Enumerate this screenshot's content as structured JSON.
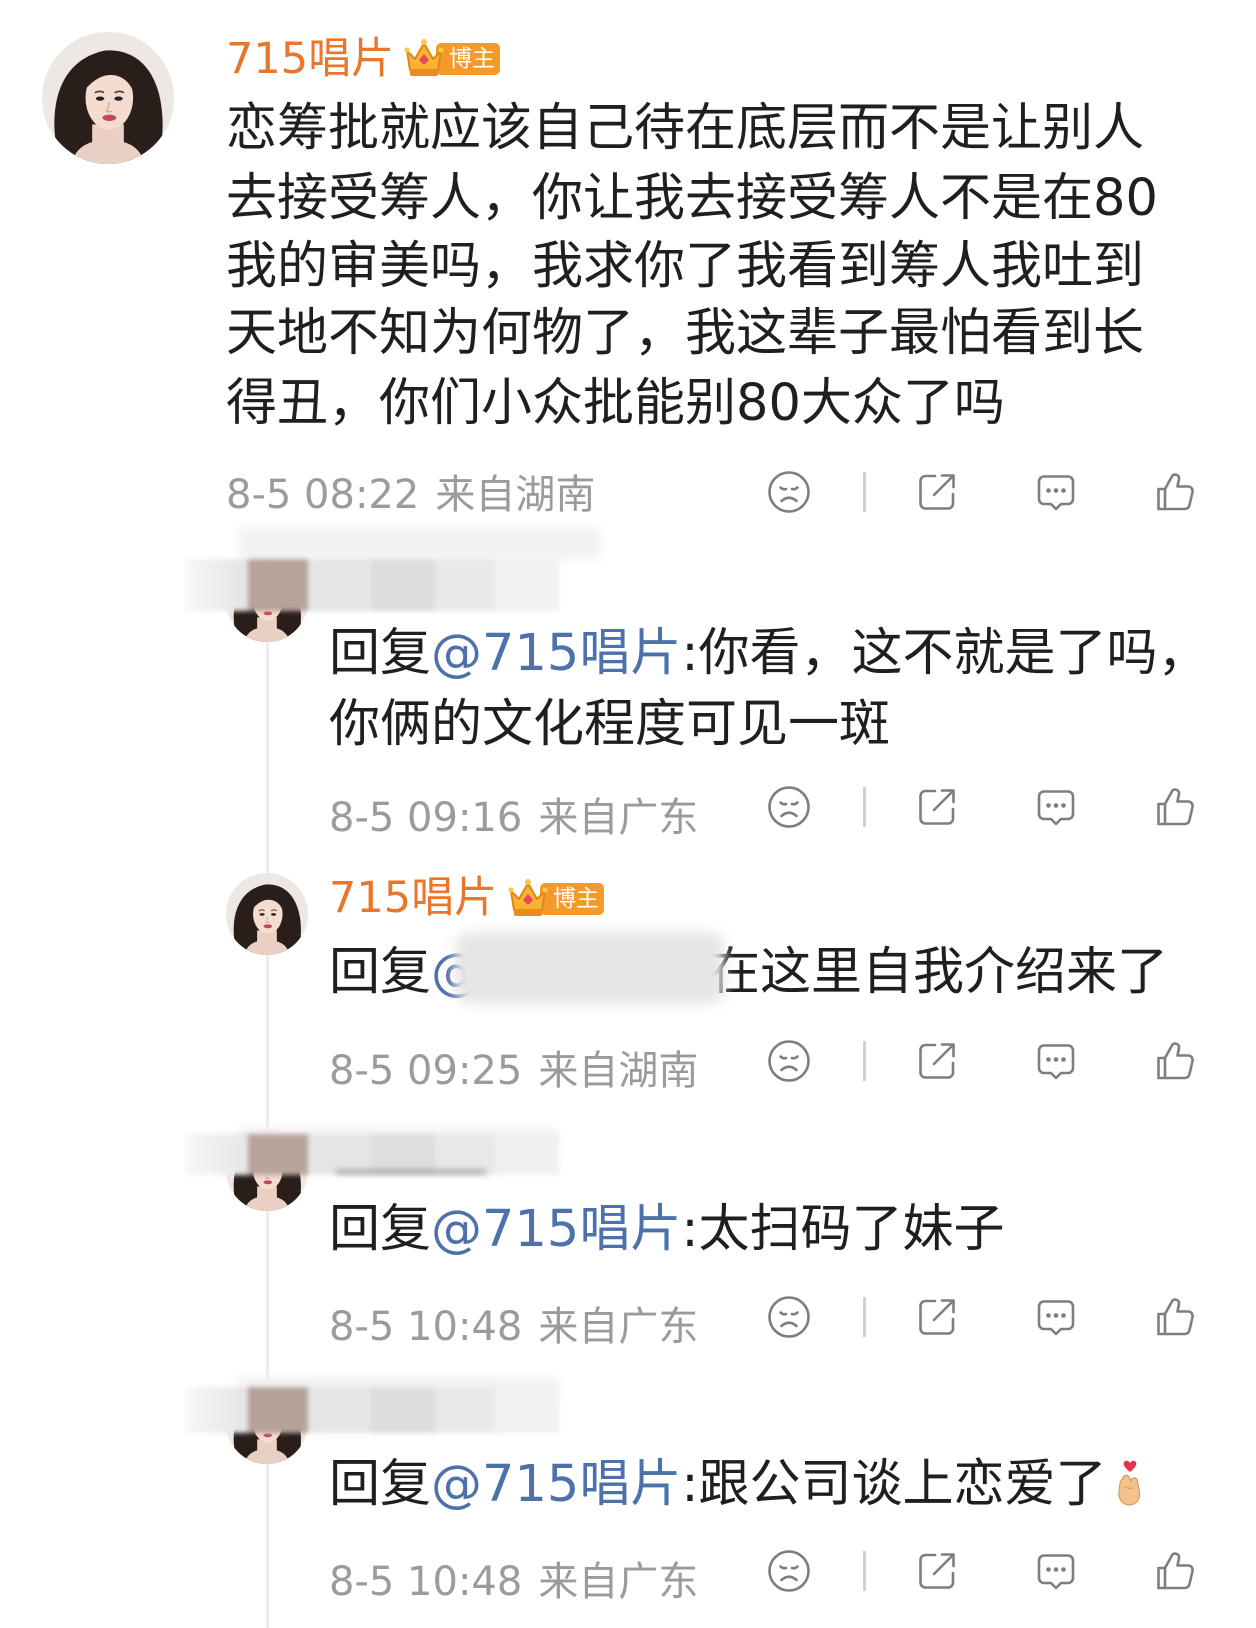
{
  "colors": {
    "username": "#E8762D",
    "mention": "#4D72AB",
    "text": "#1F1F1F",
    "meta": "#9B9B9B",
    "icon": "#7E7E7E",
    "badge": "#F39A2B"
  },
  "comment": {
    "author": "715唱片",
    "badge": "博主",
    "lines": [
      "恋筹批就应该自己待在底层而不是让别人",
      "去接受筹人，你让我去接受筹人不是在80",
      "我的审美吗，我求你了我看到筹人我吐到",
      "天地不知为何物了，我这辈子最怕看到长",
      "得丑，你们小众批能别80大众了吗"
    ],
    "time": "8-5 08:22",
    "location": "来自湖南",
    "action_icons": [
      "sad-face-icon",
      "share-icon",
      "comment-icon",
      "like-icon"
    ]
  },
  "replies": [
    {
      "prefix": "回复",
      "mention": "@715唱片",
      "body": ":你看，这不就是了吗，",
      "body_line2": "你俩的文化程度可见一斑",
      "time": "8-5 09:16",
      "location": "来自广东"
    },
    {
      "author": "715唱片",
      "badge": "博主",
      "prefix": "回复",
      "mention": "@",
      "body": "在这里自我介绍来了",
      "time": "8-5 09:25",
      "location": "来自湖南"
    },
    {
      "prefix": "回复",
      "mention": "@715唱片",
      "body": ":太扫码了妹子",
      "time": "8-5 10:48",
      "location": "来自广东"
    },
    {
      "prefix": "回复",
      "mention": "@715唱片",
      "body": ":跟公司谈上恋爱了",
      "emoji": "finger-heart-icon",
      "time": "8-5 10:48",
      "location": "来自广东"
    }
  ]
}
